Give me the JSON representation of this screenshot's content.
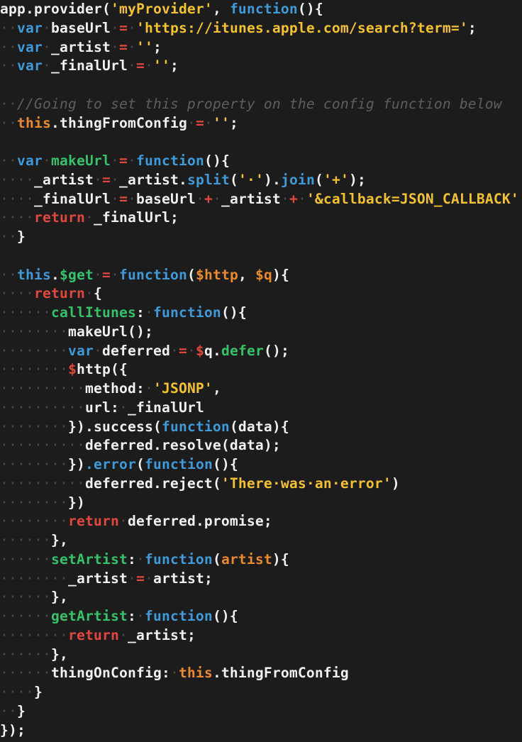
{
  "editor": {
    "theme_colors": {
      "background": "#1c1c1c",
      "plain": "#f1f1f1",
      "keyword": "#3e9ad8",
      "string": "#f2c329",
      "operator": "#e2473f",
      "function_name": "#34c26b",
      "this_param": "#ea8a2b",
      "comment": "#5e5e5e"
    },
    "lines": [
      [
        [
          "plain",
          "app.provider("
        ],
        [
          "str",
          "'myProvider'"
        ],
        [
          "plain",
          ", "
        ],
        [
          "kw",
          "function"
        ],
        [
          "plain",
          "(){"
        ]
      ],
      [
        [
          "ws",
          "··"
        ],
        [
          "kw",
          "var"
        ],
        [
          "ws",
          "·"
        ],
        [
          "plain",
          "baseUrl"
        ],
        [
          "ws",
          "·"
        ],
        [
          "op",
          "="
        ],
        [
          "ws",
          "·"
        ],
        [
          "str",
          "'https://itunes.apple.com/search?term='"
        ],
        [
          "plain",
          ";"
        ]
      ],
      [
        [
          "ws",
          "··"
        ],
        [
          "kw",
          "var"
        ],
        [
          "ws",
          "·"
        ],
        [
          "plain",
          "_artist"
        ],
        [
          "ws",
          "·"
        ],
        [
          "op",
          "="
        ],
        [
          "ws",
          "·"
        ],
        [
          "str",
          "''"
        ],
        [
          "plain",
          ";"
        ]
      ],
      [
        [
          "ws",
          "··"
        ],
        [
          "kw",
          "var"
        ],
        [
          "ws",
          "·"
        ],
        [
          "plain",
          "_finalUrl"
        ],
        [
          "ws",
          "·"
        ],
        [
          "op",
          "="
        ],
        [
          "ws",
          "·"
        ],
        [
          "str",
          "''"
        ],
        [
          "plain",
          ";"
        ]
      ],
      [],
      [
        [
          "ws",
          "··"
        ],
        [
          "cmt",
          "//Going to set this property on the config function below"
        ]
      ],
      [
        [
          "ws",
          "··"
        ],
        [
          "this",
          "this"
        ],
        [
          "plain",
          ".thingFromConfig"
        ],
        [
          "ws",
          "·"
        ],
        [
          "op",
          "="
        ],
        [
          "ws",
          "·"
        ],
        [
          "str",
          "''"
        ],
        [
          "plain",
          ";"
        ]
      ],
      [],
      [
        [
          "ws",
          "··"
        ],
        [
          "kw",
          "var"
        ],
        [
          "ws",
          "·"
        ],
        [
          "fn",
          "makeUrl"
        ],
        [
          "ws",
          "·"
        ],
        [
          "op",
          "="
        ],
        [
          "ws",
          "·"
        ],
        [
          "kw",
          "function"
        ],
        [
          "plain",
          "(){"
        ]
      ],
      [
        [
          "ws",
          "····"
        ],
        [
          "plain",
          "_artist"
        ],
        [
          "ws",
          "·"
        ],
        [
          "op",
          "="
        ],
        [
          "ws",
          "·"
        ],
        [
          "plain",
          "_artist."
        ],
        [
          "kw",
          "split"
        ],
        [
          "plain",
          "("
        ],
        [
          "str",
          "'·'"
        ],
        [
          "plain",
          ")."
        ],
        [
          "kw",
          "join"
        ],
        [
          "plain",
          "("
        ],
        [
          "str",
          "'+'"
        ],
        [
          "plain",
          ");"
        ]
      ],
      [
        [
          "ws",
          "····"
        ],
        [
          "plain",
          "_finalUrl"
        ],
        [
          "ws",
          "·"
        ],
        [
          "op",
          "="
        ],
        [
          "ws",
          "·"
        ],
        [
          "plain",
          "baseUrl"
        ],
        [
          "ws",
          "·"
        ],
        [
          "op",
          "+"
        ],
        [
          "ws",
          "·"
        ],
        [
          "plain",
          "_artist"
        ],
        [
          "ws",
          "·"
        ],
        [
          "op",
          "+"
        ],
        [
          "ws",
          "·"
        ],
        [
          "str",
          "'&callback=JSON_CALLBACK'"
        ]
      ],
      [
        [
          "ws",
          "····"
        ],
        [
          "ret",
          "return"
        ],
        [
          "ws",
          "·"
        ],
        [
          "plain",
          "_finalUrl;"
        ]
      ],
      [
        [
          "ws",
          "··"
        ],
        [
          "plain",
          "}"
        ]
      ],
      [],
      [
        [
          "ws",
          "··"
        ],
        [
          "kw",
          "this"
        ],
        [
          "plain",
          "."
        ],
        [
          "fn",
          "$get"
        ],
        [
          "ws",
          "·"
        ],
        [
          "op",
          "="
        ],
        [
          "ws",
          "·"
        ],
        [
          "kw",
          "function"
        ],
        [
          "plain",
          "("
        ],
        [
          "param",
          "$http"
        ],
        [
          "plain",
          ", "
        ],
        [
          "param",
          "$q"
        ],
        [
          "plain",
          "){"
        ]
      ],
      [
        [
          "ws",
          "····"
        ],
        [
          "ret",
          "return"
        ],
        [
          "ws",
          "·"
        ],
        [
          "plain",
          "{"
        ]
      ],
      [
        [
          "ws",
          "······"
        ],
        [
          "fn",
          "callItunes"
        ],
        [
          "plain",
          ":"
        ],
        [
          "ws",
          "·"
        ],
        [
          "kw",
          "function"
        ],
        [
          "plain",
          "(){"
        ]
      ],
      [
        [
          "ws",
          "········"
        ],
        [
          "plain",
          "makeUrl();"
        ]
      ],
      [
        [
          "ws",
          "········"
        ],
        [
          "kw",
          "var"
        ],
        [
          "ws",
          "·"
        ],
        [
          "plain",
          "deferred"
        ],
        [
          "ws",
          "·"
        ],
        [
          "op",
          "="
        ],
        [
          "ws",
          "·"
        ],
        [
          "dollar",
          "$"
        ],
        [
          "plain",
          "q."
        ],
        [
          "fn",
          "defer"
        ],
        [
          "plain",
          "();"
        ]
      ],
      [
        [
          "ws",
          "········"
        ],
        [
          "dollar",
          "$"
        ],
        [
          "plain",
          "http({"
        ]
      ],
      [
        [
          "ws",
          "··········"
        ],
        [
          "plain",
          "method:"
        ],
        [
          "ws",
          "·"
        ],
        [
          "str",
          "'JSONP'"
        ],
        [
          "plain",
          ","
        ]
      ],
      [
        [
          "ws",
          "··········"
        ],
        [
          "plain",
          "url:"
        ],
        [
          "ws",
          "·"
        ],
        [
          "plain",
          "_finalUrl"
        ]
      ],
      [
        [
          "ws",
          "········"
        ],
        [
          "plain",
          "}).success("
        ],
        [
          "kw",
          "function"
        ],
        [
          "plain",
          "(data){"
        ]
      ],
      [
        [
          "ws",
          "··········"
        ],
        [
          "plain",
          "deferred.resolve(data);"
        ]
      ],
      [
        [
          "ws",
          "········"
        ],
        [
          "plain",
          "})"
        ],
        [
          "kw",
          ".error"
        ],
        [
          "plain",
          "("
        ],
        [
          "kw",
          "function"
        ],
        [
          "plain",
          "(){"
        ]
      ],
      [
        [
          "ws",
          "··········"
        ],
        [
          "plain",
          "deferred.reject("
        ],
        [
          "str",
          "'There·was·an·error'"
        ],
        [
          "plain",
          ")"
        ]
      ],
      [
        [
          "ws",
          "········"
        ],
        [
          "plain",
          "})"
        ]
      ],
      [
        [
          "ws",
          "········"
        ],
        [
          "ret",
          "return"
        ],
        [
          "ws",
          "·"
        ],
        [
          "plain",
          "deferred.promise;"
        ]
      ],
      [
        [
          "ws",
          "······"
        ],
        [
          "plain",
          "},"
        ]
      ],
      [
        [
          "ws",
          "······"
        ],
        [
          "fn",
          "setArtist"
        ],
        [
          "plain",
          ":"
        ],
        [
          "ws",
          "·"
        ],
        [
          "kw",
          "function"
        ],
        [
          "plain",
          "("
        ],
        [
          "param",
          "artist"
        ],
        [
          "plain",
          "){"
        ]
      ],
      [
        [
          "ws",
          "········"
        ],
        [
          "plain",
          "_artist"
        ],
        [
          "ws",
          "·"
        ],
        [
          "op",
          "="
        ],
        [
          "ws",
          "·"
        ],
        [
          "plain",
          "artist;"
        ]
      ],
      [
        [
          "ws",
          "······"
        ],
        [
          "plain",
          "},"
        ]
      ],
      [
        [
          "ws",
          "······"
        ],
        [
          "fn",
          "getArtist"
        ],
        [
          "plain",
          ":"
        ],
        [
          "ws",
          "·"
        ],
        [
          "kw",
          "function"
        ],
        [
          "plain",
          "(){"
        ]
      ],
      [
        [
          "ws",
          "········"
        ],
        [
          "ret",
          "return"
        ],
        [
          "ws",
          "·"
        ],
        [
          "plain",
          "_artist;"
        ]
      ],
      [
        [
          "ws",
          "······"
        ],
        [
          "plain",
          "},"
        ]
      ],
      [
        [
          "ws",
          "······"
        ],
        [
          "plain",
          "thingOnConfig:"
        ],
        [
          "ws",
          "·"
        ],
        [
          "this",
          "this"
        ],
        [
          "plain",
          ".thingFromConfig"
        ]
      ],
      [
        [
          "ws",
          "····"
        ],
        [
          "plain",
          "}"
        ]
      ],
      [
        [
          "ws",
          "··"
        ],
        [
          "plain",
          "}"
        ]
      ],
      [
        [
          "plain",
          "});"
        ]
      ]
    ]
  }
}
